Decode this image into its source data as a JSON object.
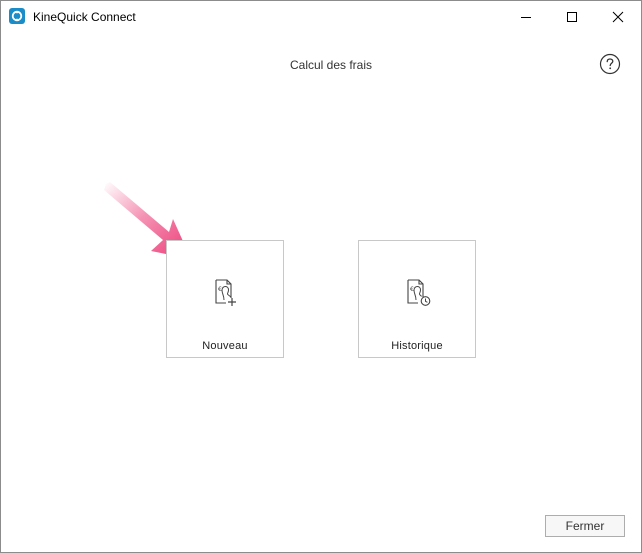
{
  "window": {
    "title": "KineQuick Connect",
    "controls": {
      "minimize": "minimize-icon",
      "maximize": "maximize-icon",
      "close": "close-icon"
    }
  },
  "header": {
    "title": "Calcul des frais",
    "help_icon": "question-circle-icon"
  },
  "tiles": [
    {
      "label": "Nouveau",
      "icon": "document-euro-add-icon"
    },
    {
      "label": "Historique",
      "icon": "document-euro-history-icon"
    }
  ],
  "footer": {
    "close_label": "Fermer"
  },
  "colors": {
    "accent": "#1a8cc8",
    "arrow": "#ec3a75"
  }
}
